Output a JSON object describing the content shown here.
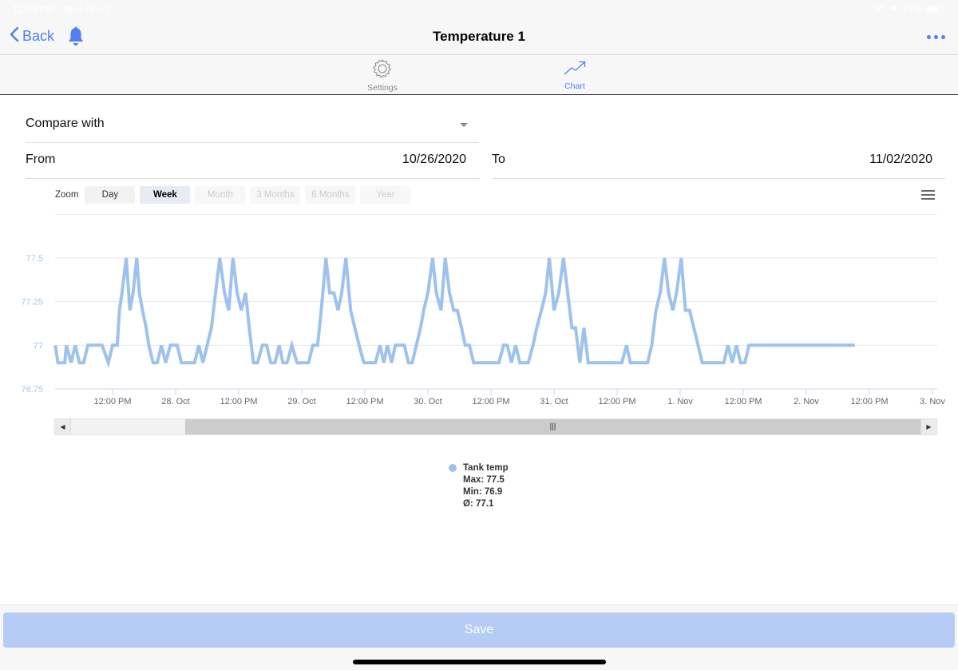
{
  "status_bar": {
    "time": "12:33 PM",
    "date": "Mon Nov 2",
    "battery": "77%"
  },
  "nav": {
    "back_label": "Back",
    "title": "Temperature 1"
  },
  "tabs": [
    {
      "label": "Settings",
      "icon": "gear-icon",
      "active": false
    },
    {
      "label": "Chart",
      "icon": "trend-chart-icon",
      "active": true
    }
  ],
  "form": {
    "compare_label": "Compare with",
    "compare_value": "",
    "from_label": "From",
    "from_value": "10/26/2020",
    "to_label": "To",
    "to_value": "11/02/2020"
  },
  "zoom": {
    "label": "Zoom",
    "options": [
      {
        "label": "Day",
        "state": "enabled"
      },
      {
        "label": "Week",
        "state": "active"
      },
      {
        "label": "Month",
        "state": "disabled"
      },
      {
        "label": "3 Months",
        "state": "disabled"
      },
      {
        "label": "6 Months",
        "state": "disabled"
      },
      {
        "label": "Year",
        "state": "disabled"
      }
    ]
  },
  "colors": {
    "accent": "#4f7ff0",
    "series": "#9ec2ee",
    "axis_label": "#a9c5ee",
    "save_button": "#b6cbf5"
  },
  "chart_data": {
    "type": "line",
    "title": "",
    "xlabel": "",
    "ylabel": "",
    "ylim": [
      76.75,
      77.5
    ],
    "yticks": [
      76.75,
      77,
      77.25,
      77.5
    ],
    "ytick_labels": [
      "76.75",
      "77",
      "77.25",
      "77.5"
    ],
    "xlim_hours_from_oct27": [
      1.1,
      85.7
    ],
    "xticks": [
      {
        "hours": 12,
        "label": "12:00 PM"
      },
      {
        "hours": 24,
        "label": "28. Oct"
      },
      {
        "hours": 36,
        "label": "12:00 PM"
      },
      {
        "hours": 48,
        "label": "29. Oct"
      },
      {
        "hours": 60,
        "label": "12:00 PM"
      },
      {
        "hours": 72,
        "label": "30. Oct"
      },
      {
        "hours": 84,
        "label": "12:00 PM"
      },
      {
        "hours": 96,
        "label": "31. Oct"
      },
      {
        "hours": 108,
        "label": "12:00 PM"
      },
      {
        "hours": 120,
        "label": "1. Nov"
      },
      {
        "hours": 132,
        "label": "12:00 PM"
      },
      {
        "hours": 144,
        "label": "2. Nov"
      },
      {
        "hours": 156,
        "label": "12:00 PM"
      },
      {
        "hours": 168,
        "label": "3. Nov"
      }
    ],
    "grid": true,
    "legend_position": "bottom-center",
    "series": [
      {
        "name": "Tank temp",
        "max": "77.5",
        "min": "76.9",
        "avg": "77.1",
        "x_hours_from_oct27": [
          1.1,
          1.6,
          2.9,
          3.2,
          4.1,
          4.9,
          5.7,
          6.5,
          7.3,
          8.1,
          9.2,
          10.0,
          11.2,
          12.0,
          12.9,
          13.3,
          13.8,
          14.6,
          15.3,
          15.9,
          16.6,
          17.1,
          17.7,
          18.4,
          18.9,
          19.7,
          20.5,
          21.3,
          22.1,
          23.0,
          24.3,
          25.1,
          25.9,
          26.8,
          27.6,
          28.4,
          29.2,
          30.0,
          30.8,
          31.6,
          32.4,
          33.3,
          34.1,
          34.9,
          35.7,
          36.5,
          37.3,
          38.0,
          38.8,
          39.6,
          40.5,
          41.3,
          42.1,
          42.9,
          43.7,
          44.4,
          45.2,
          46.1,
          47.1,
          48.4,
          49.3,
          50.1,
          51.0,
          51.7,
          52.6,
          53.3,
          54.1,
          54.9,
          55.6,
          56.4,
          57.3,
          58.1,
          58.9,
          59.8,
          60.6,
          61.3,
          62.0,
          62.9,
          63.6,
          64.3,
          65.1,
          65.8,
          66.8,
          67.5,
          68.3,
          69.0,
          69.8,
          70.6,
          71.2,
          72.0,
          72.9,
          73.6,
          74.5,
          75.3,
          76.1,
          76.9,
          77.6,
          78.4,
          79.1,
          79.9,
          80.7,
          81.5,
          82.3,
          83.1,
          83.9,
          84.7,
          85.5,
          86.4,
          87.1,
          87.9,
          88.7,
          89.5,
          90.3,
          91.1,
          92.0,
          92.7,
          93.6,
          94.4,
          95.1,
          96.0,
          96.9,
          97.8,
          98.6,
          99.4,
          100.1,
          100.9,
          101.7,
          102.5,
          103.3,
          104.1,
          104.9,
          105.7,
          106.5,
          107.4,
          108.2,
          108.9,
          109.8,
          110.5,
          111.3,
          112.1,
          113.0,
          113.8,
          114.6,
          115.4,
          116.2,
          117.0,
          117.8,
          118.6,
          119.3,
          120.2,
          121.0,
          121.8,
          122.6,
          123.4,
          124.2,
          125.0,
          125.8,
          126.6,
          127.4,
          128.3,
          129.1,
          129.9,
          130.7,
          131.5,
          132.3,
          133.1,
          133.9,
          134.6,
          135.5,
          136.3,
          137.0,
          137.9,
          138.7,
          139.5,
          140.3,
          141.1,
          141.5,
          142.0,
          142.8,
          143.6,
          144.4,
          145.2,
          146.0,
          146.8,
          147.6,
          148.4,
          149.2,
          150.0,
          150.8,
          151.6,
          152.4,
          153.2
        ],
        "y": [
          77.0,
          76.9,
          76.9,
          77.0,
          76.9,
          77.0,
          76.9,
          76.9,
          77.0,
          77.0,
          77.0,
          77.0,
          76.9,
          77.0,
          77.0,
          77.2,
          77.3,
          77.5,
          77.2,
          77.3,
          77.5,
          77.3,
          77.2,
          77.1,
          77.0,
          76.9,
          76.9,
          77.0,
          76.9,
          77.0,
          77.0,
          76.9,
          76.9,
          76.9,
          76.9,
          77.0,
          76.9,
          77.0,
          77.1,
          77.3,
          77.5,
          77.3,
          77.2,
          77.5,
          77.3,
          77.2,
          77.3,
          77.1,
          76.9,
          76.9,
          77.0,
          77.0,
          76.9,
          76.9,
          77.0,
          76.9,
          76.9,
          77.0,
          76.9,
          76.9,
          76.9,
          77.0,
          77.0,
          77.2,
          77.5,
          77.3,
          77.3,
          77.2,
          77.3,
          77.5,
          77.2,
          77.1,
          77.0,
          76.9,
          76.9,
          76.9,
          76.9,
          77.0,
          76.9,
          77.0,
          76.9,
          77.0,
          77.0,
          77.0,
          76.9,
          76.9,
          77.0,
          77.1,
          77.2,
          77.3,
          77.5,
          77.3,
          77.2,
          77.5,
          77.3,
          77.2,
          77.2,
          77.1,
          77.0,
          77.0,
          76.9,
          76.9,
          76.9,
          76.9,
          76.9,
          76.9,
          76.9,
          77.0,
          77.0,
          76.9,
          77.0,
          76.9,
          76.9,
          76.9,
          77.0,
          77.1,
          77.2,
          77.3,
          77.5,
          77.2,
          77.3,
          77.5,
          77.3,
          77.1,
          77.1,
          76.9,
          77.1,
          76.9,
          76.9,
          76.9,
          76.9,
          76.9,
          76.9,
          76.9,
          76.9,
          76.9,
          77.0,
          76.9,
          76.9,
          76.9,
          76.9,
          76.9,
          77.0,
          77.2,
          77.3,
          77.5,
          77.3,
          77.2,
          77.3,
          77.5,
          77.2,
          77.2,
          77.1,
          77.0,
          76.9,
          76.9,
          76.9,
          76.9,
          76.9,
          76.9,
          77.0,
          76.9,
          77.0,
          76.9,
          76.9,
          77.0,
          77.0,
          77.0,
          77.0,
          77.0,
          77.0,
          77.0,
          77.0,
          77.0,
          77.0,
          77.0,
          77.0,
          77.0,
          77.0,
          77.0,
          77.0,
          77.0,
          77.0,
          77.0,
          77.0,
          77.0,
          77.0,
          77.0,
          77.0,
          77.0,
          77.0,
          77.0,
          77.0,
          77.0,
          77.0
        ]
      }
    ]
  },
  "legend": {
    "series_name": "Tank temp",
    "max_text": "Max: 77.5",
    "min_text": "Min: 76.9",
    "avg_text": "Ø: 77.1"
  },
  "scrollbar": {
    "grip_label": "|||"
  },
  "footer": {
    "save_label": "Save"
  }
}
